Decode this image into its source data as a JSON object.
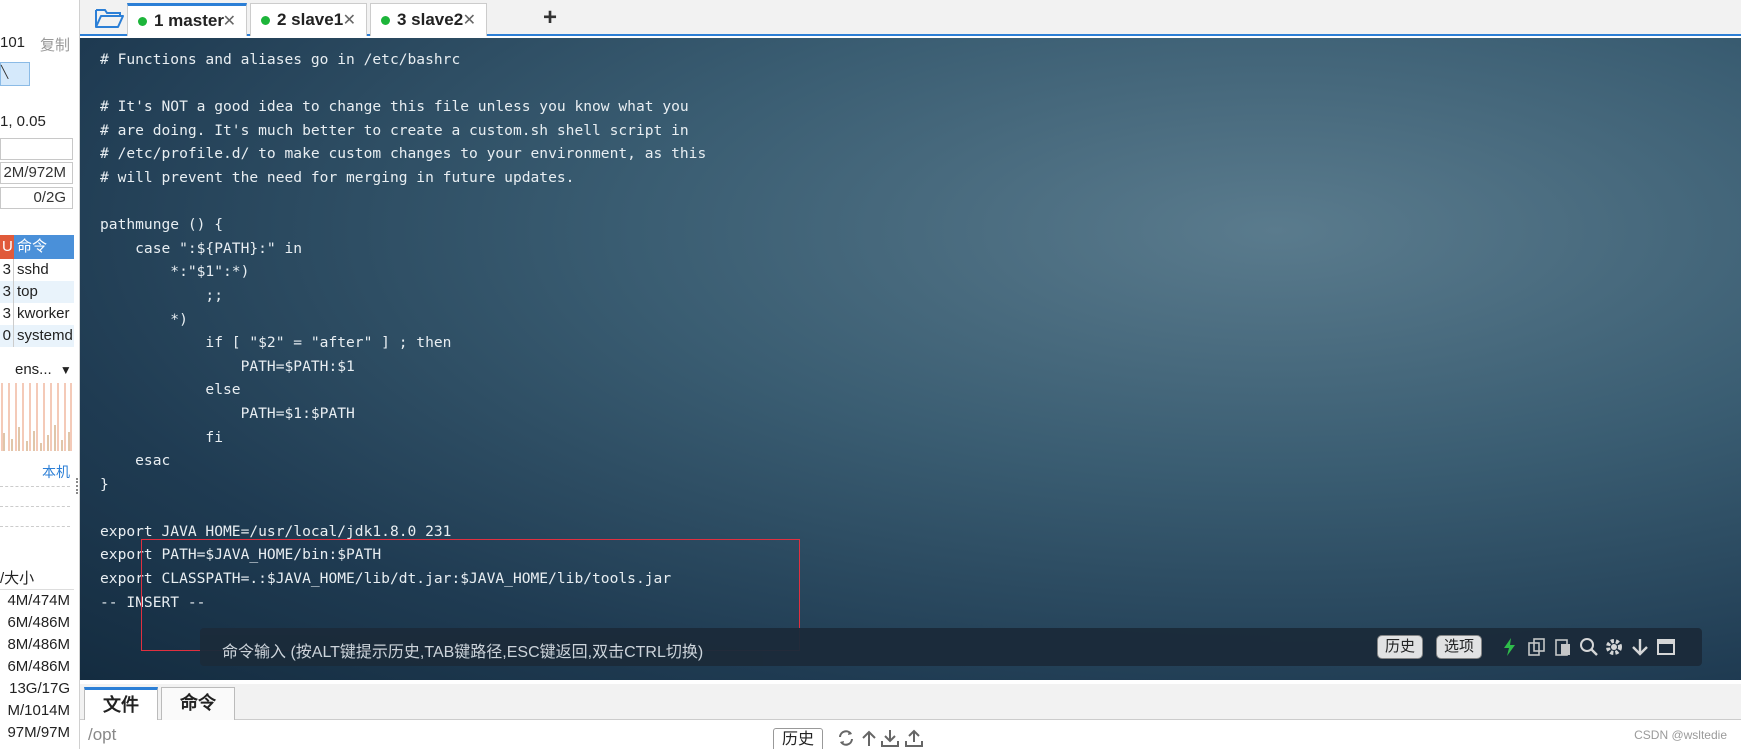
{
  "sidebar": {
    "ip_text": "101",
    "copy_label": "复制",
    "load_text": "1, 0.05",
    "mem_text": "2M/972M",
    "swap_text": "0/2G",
    "proc_header": {
      "col1": "U",
      "col2": "命令"
    },
    "processes": [
      {
        "col1": "3",
        "name": "sshd"
      },
      {
        "col1": "3",
        "name": "top"
      },
      {
        "col1": "3",
        "name": "kworker"
      },
      {
        "col1": "0",
        "name": "systemd"
      }
    ],
    "net_iface": "ens...",
    "net_local": "本机",
    "disk_header": "/大小",
    "disks": [
      "4M/474M",
      "6M/486M",
      "8M/486M",
      "6M/486M",
      "13G/17G",
      "M/1014M",
      "97M/97M"
    ]
  },
  "tabs": [
    {
      "label": "1 master",
      "active": true
    },
    {
      "label": "2 slave1",
      "active": false
    },
    {
      "label": "3 slave2",
      "active": false
    }
  ],
  "terminal": {
    "lines": [
      "# Functions and aliases go in /etc/bashrc",
      "",
      "# It's NOT a good idea to change this file unless you know what you",
      "# are doing. It's much better to create a custom.sh shell script in",
      "# /etc/profile.d/ to make custom changes to your environment, as this",
      "# will prevent the need for merging in future updates.",
      "",
      "pathmunge () {",
      "    case \":${PATH}:\" in",
      "        *:\"$1\":*)",
      "            ;;",
      "        *)",
      "            if [ \"$2\" = \"after\" ] ; then",
      "                PATH=$PATH:$1",
      "            else",
      "                PATH=$1:$PATH",
      "            fi",
      "    esac",
      "}",
      "",
      "export JAVA_HOME=/usr/local/jdk1.8.0_231",
      "export PATH=$JAVA_HOME/bin:$PATH",
      "export CLASSPATH=.:$JAVA_HOME/lib/dt.jar:$JAVA_HOME/lib/tools.jar",
      "-- INSERT --"
    ]
  },
  "cmdbar": {
    "placeholder": "命令输入 (按ALT键提示历史,TAB键路径,ESC键返回,双击CTRL切换)",
    "history_label": "历史",
    "options_label": "选项"
  },
  "bottom_tabs": [
    {
      "label": "文件",
      "active": true
    },
    {
      "label": "命令",
      "active": false
    }
  ],
  "pathbar": {
    "path": "/opt",
    "history_label": "历史"
  },
  "watermark": "CSDN @wsltedie",
  "colors": {
    "accent": "#2c7fd6",
    "status_dot": "#1db53a",
    "highlight_box": "#e03040",
    "bolt": "#2fc14a"
  }
}
